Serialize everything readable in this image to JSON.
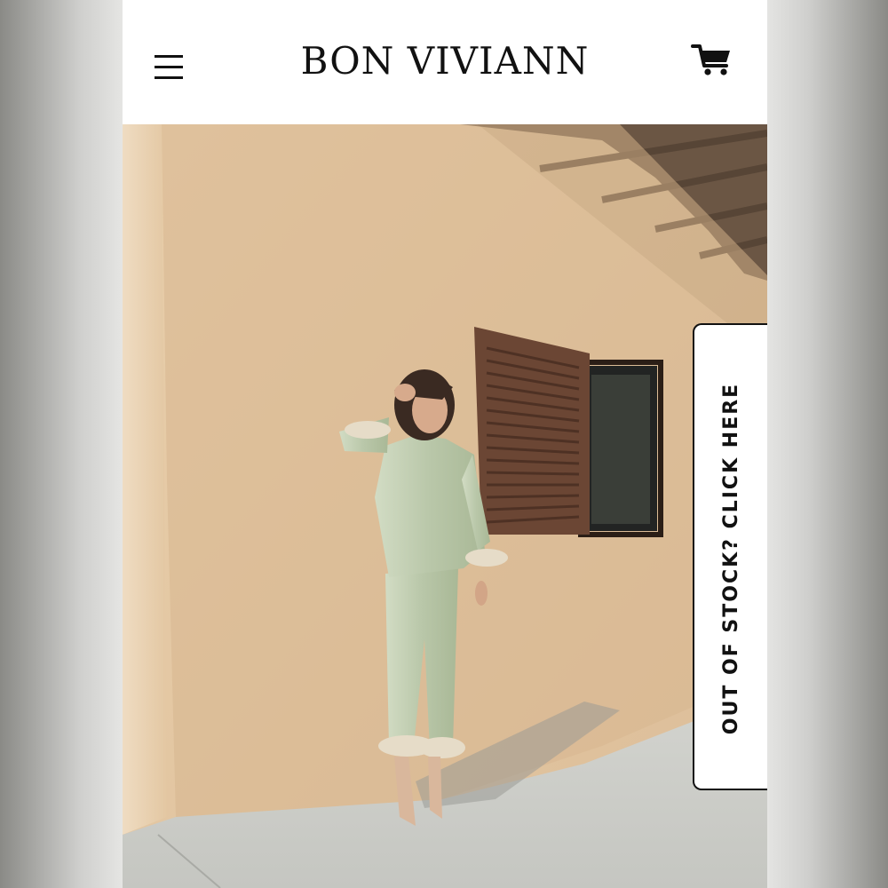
{
  "header": {
    "brand": "BON VIVIANN",
    "menu_icon": "hamburger-menu-icon",
    "cart_icon": "shopping-cart-icon"
  },
  "hero": {
    "subject": "model wearing sage satin feather-trim pajama set against stucco wall"
  },
  "side_tab": {
    "label": "OUT OF STOCK? CLICK HERE"
  },
  "colors": {
    "wall": "#e2c6a3",
    "wall_shadow": "#c6a680",
    "pajama": "#bcc9ad",
    "shutter": "#6b4634",
    "sidewalk": "#cfd0cc"
  }
}
